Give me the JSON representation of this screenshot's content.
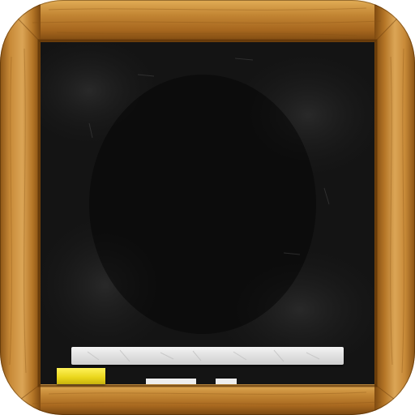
{
  "app_icon": {
    "icon_name": "chalkboard-icon",
    "colors": {
      "frame_wood": "#b77a2a",
      "frame_wood_dark": "#8a5516",
      "frame_wood_light": "#d9a04a",
      "board": "#121212",
      "chalk": "#e6e6e6",
      "eraser": "#efdc26"
    },
    "parts": {
      "frame": "wooden-frame",
      "board": "blackboard",
      "chalk_stick": "chalk-stick",
      "eraser": "yellow-eraser",
      "small_chalk_pieces": 2
    }
  }
}
